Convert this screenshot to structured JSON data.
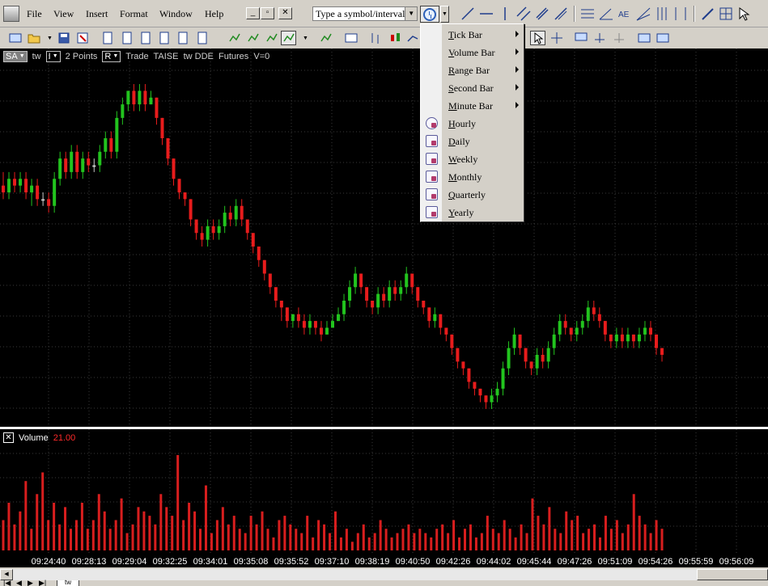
{
  "menubar": {
    "items": [
      {
        "label": "File"
      },
      {
        "label": "View"
      },
      {
        "label": "Insert"
      },
      {
        "label": "Format"
      },
      {
        "label": "Window"
      },
      {
        "label": "Help"
      }
    ],
    "symbol_input": "Type a symbol/interval"
  },
  "interval_menu": {
    "items": [
      {
        "label": "Tick Bar",
        "submenu": true
      },
      {
        "label": "Volume Bar",
        "submenu": true
      },
      {
        "label": "Range Bar",
        "submenu": true
      },
      {
        "label": "Second Bar",
        "submenu": true
      },
      {
        "label": "Minute Bar",
        "submenu": true
      },
      {
        "label": "Hourly",
        "submenu": false
      },
      {
        "label": "Daily",
        "submenu": false
      },
      {
        "label": "Weekly",
        "submenu": false
      },
      {
        "label": "Monthly",
        "submenu": false
      },
      {
        "label": "Quarterly",
        "submenu": false
      },
      {
        "label": "Yearly",
        "submenu": false
      }
    ]
  },
  "chart_header": {
    "symbol_box": "SA",
    "symbol_suffix": "tw",
    "interval_box": "I",
    "interval_text": "2 Points",
    "type_box": "R",
    "description": "Trade  TAISE  tw DDE  Futures  V=0"
  },
  "volume_panel": {
    "title": "Volume",
    "value": "21.00"
  },
  "sheet_tab": "tw",
  "colors": {
    "up": "#22c41e",
    "down": "#e81c1c",
    "doji": "#c8c8c8",
    "volume": "#d81e1e",
    "grid": "#3a3a3a"
  },
  "chart_data": [
    {
      "type": "candlestick",
      "title": "",
      "x_labels": [
        "09:24:40",
        "09:28:13",
        "09:29:04",
        "09:32:25",
        "09:34:01",
        "09:35:08",
        "09:35:52",
        "09:37:10",
        "09:38:19",
        "09:40:50",
        "09:42:26",
        "09:44:02",
        "09:45:44",
        "09:47:26",
        "09:51:09",
        "09:54:26",
        "09:55:59",
        "09:56:09"
      ],
      "ohlc": [
        [
          57,
          56,
          59,
          55
        ],
        [
          56,
          58,
          59,
          55
        ],
        [
          58,
          57,
          59,
          56
        ],
        [
          57,
          58,
          59,
          56
        ],
        [
          58,
          56,
          59,
          55
        ],
        [
          56,
          57,
          58,
          54
        ],
        [
          57,
          55,
          58,
          54
        ],
        [
          55,
          55,
          56,
          54
        ],
        [
          55,
          54,
          56,
          53
        ],
        [
          54,
          58,
          59,
          53
        ],
        [
          58,
          61,
          62,
          57
        ],
        [
          61,
          59,
          62,
          58
        ],
        [
          59,
          62,
          63,
          58
        ],
        [
          62,
          59,
          63,
          58
        ],
        [
          59,
          61,
          62,
          58
        ],
        [
          61,
          60,
          62,
          59
        ],
        [
          60,
          60,
          61,
          59
        ],
        [
          60,
          62,
          63,
          59
        ],
        [
          62,
          64,
          65,
          61
        ],
        [
          64,
          62,
          65,
          61
        ],
        [
          62,
          67,
          68,
          61
        ],
        [
          67,
          69,
          70,
          66
        ],
        [
          69,
          71,
          71,
          68
        ],
        [
          71,
          69,
          72,
          68
        ],
        [
          69,
          71,
          72,
          68
        ],
        [
          71,
          69,
          72,
          68
        ],
        [
          69,
          70,
          71,
          69
        ],
        [
          70,
          67,
          70,
          66
        ],
        [
          67,
          64,
          67,
          63
        ],
        [
          64,
          61,
          64,
          60
        ],
        [
          61,
          58,
          61,
          57
        ],
        [
          58,
          56,
          58,
          55
        ],
        [
          56,
          55,
          56,
          54
        ],
        [
          55,
          52,
          55,
          51
        ],
        [
          52,
          50,
          52,
          49
        ],
        [
          50,
          49,
          51,
          48
        ],
        [
          49,
          51,
          52,
          48
        ],
        [
          51,
          50,
          52,
          49
        ],
        [
          50,
          51,
          52,
          49
        ],
        [
          51,
          53,
          54,
          50
        ],
        [
          53,
          52,
          54,
          51
        ],
        [
          52,
          54,
          55,
          51
        ],
        [
          54,
          52,
          55,
          51
        ],
        [
          52,
          50,
          52,
          49
        ],
        [
          50,
          48,
          50,
          47
        ],
        [
          48,
          46,
          48,
          45
        ],
        [
          46,
          44,
          46,
          43
        ],
        [
          44,
          42,
          44,
          41
        ],
        [
          42,
          40,
          42,
          39
        ],
        [
          40,
          39,
          40,
          37
        ],
        [
          39,
          37,
          39,
          36
        ],
        [
          37,
          38,
          38,
          36
        ],
        [
          38,
          37,
          39,
          36
        ],
        [
          37,
          36,
          38,
          35
        ],
        [
          36,
          37,
          38,
          35
        ],
        [
          37,
          36,
          37,
          35
        ],
        [
          36,
          35,
          37,
          34
        ],
        [
          35,
          36,
          37,
          35
        ],
        [
          36,
          37,
          38,
          36
        ],
        [
          37,
          38,
          39,
          37
        ],
        [
          38,
          40,
          41,
          37
        ],
        [
          40,
          42,
          43,
          39
        ],
        [
          42,
          44,
          45,
          41
        ],
        [
          44,
          42,
          44,
          41
        ],
        [
          42,
          40,
          42,
          39
        ],
        [
          40,
          39,
          40,
          38
        ],
        [
          39,
          41,
          42,
          38
        ],
        [
          41,
          40,
          42,
          39
        ],
        [
          40,
          42,
          43,
          39
        ],
        [
          42,
          41,
          43,
          40
        ],
        [
          41,
          42,
          43,
          40
        ],
        [
          42,
          44,
          45,
          41
        ],
        [
          44,
          42,
          44,
          41
        ],
        [
          42,
          40,
          42,
          39
        ],
        [
          40,
          39,
          40,
          38
        ],
        [
          39,
          37,
          39,
          36
        ],
        [
          37,
          38,
          39,
          36
        ],
        [
          38,
          36,
          38,
          35
        ],
        [
          36,
          35,
          36,
          34
        ],
        [
          35,
          33,
          35,
          32
        ],
        [
          33,
          31,
          33,
          30
        ],
        [
          31,
          30,
          31,
          29
        ],
        [
          30,
          28,
          30,
          27
        ],
        [
          28,
          27,
          28,
          26
        ],
        [
          27,
          26,
          27,
          25
        ],
        [
          26,
          25,
          26,
          24
        ],
        [
          25,
          26,
          27,
          24
        ],
        [
          26,
          27,
          28,
          25
        ],
        [
          27,
          30,
          31,
          26
        ],
        [
          30,
          33,
          34,
          29
        ],
        [
          33,
          35,
          36,
          32
        ],
        [
          35,
          33,
          35,
          32
        ],
        [
          33,
          31,
          33,
          30
        ],
        [
          31,
          30,
          31,
          29
        ],
        [
          30,
          32,
          33,
          29
        ],
        [
          32,
          31,
          33,
          30
        ],
        [
          31,
          33,
          34,
          30
        ],
        [
          33,
          35,
          36,
          32
        ],
        [
          35,
          37,
          38,
          34
        ],
        [
          37,
          36,
          38,
          35
        ],
        [
          36,
          35,
          36,
          34
        ],
        [
          35,
          36,
          37,
          34
        ],
        [
          36,
          37,
          38,
          35
        ],
        [
          37,
          39,
          40,
          36
        ],
        [
          39,
          38,
          40,
          37
        ],
        [
          38,
          37,
          39,
          36
        ],
        [
          37,
          35,
          37,
          34
        ],
        [
          35,
          34,
          35,
          33
        ],
        [
          34,
          35,
          36,
          33
        ],
        [
          35,
          34,
          36,
          33
        ],
        [
          34,
          35,
          36,
          33
        ],
        [
          35,
          34,
          35,
          33
        ],
        [
          34,
          35,
          36,
          33
        ],
        [
          35,
          36,
          37,
          34
        ],
        [
          36,
          35,
          37,
          34
        ],
        [
          35,
          33,
          35,
          32
        ],
        [
          33,
          32,
          33,
          31
        ]
      ]
    },
    {
      "type": "bar",
      "title": "Volume",
      "values": [
        7,
        11,
        6,
        9,
        16,
        5,
        13,
        18,
        7,
        11,
        6,
        10,
        5,
        7,
        11,
        5,
        7,
        13,
        9,
        5,
        7,
        12,
        4,
        6,
        10,
        9,
        8,
        6,
        13,
        10,
        8,
        22,
        7,
        11,
        9,
        5,
        15,
        4,
        7,
        10,
        6,
        8,
        5,
        4,
        8,
        6,
        9,
        5,
        3,
        7,
        8,
        6,
        5,
        4,
        8,
        3,
        7,
        6,
        4,
        9,
        3,
        5,
        2,
        4,
        6,
        3,
        4,
        7,
        5,
        3,
        4,
        5,
        6,
        4,
        5,
        4,
        3,
        5,
        6,
        4,
        7,
        3,
        5,
        6,
        3,
        4,
        8,
        5,
        4,
        7,
        5,
        3,
        6,
        4,
        12,
        8,
        6,
        10,
        5,
        4,
        9,
        7,
        8,
        4,
        5,
        6,
        3,
        8,
        5,
        7,
        4,
        6,
        13,
        8,
        6,
        4,
        7,
        5
      ]
    }
  ]
}
